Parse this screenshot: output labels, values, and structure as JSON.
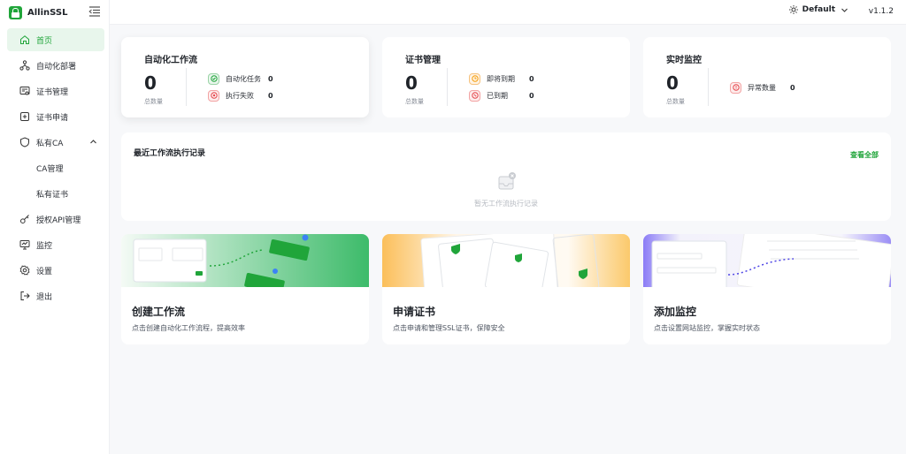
{
  "app": {
    "name": "AllinSSL",
    "theme_label": "Default",
    "version": "v1.1.2"
  },
  "sidebar": {
    "items": [
      {
        "label": "首页",
        "icon": "home-icon"
      },
      {
        "label": "自动化部署",
        "icon": "workflow-icon"
      },
      {
        "label": "证书管理",
        "icon": "certificate-icon"
      },
      {
        "label": "证书申请",
        "icon": "plus-square-icon"
      },
      {
        "label": "私有CA",
        "icon": "shield-icon"
      },
      {
        "label": "CA管理",
        "icon": ""
      },
      {
        "label": "私有证书",
        "icon": ""
      },
      {
        "label": "授权API管理",
        "icon": "key-icon"
      },
      {
        "label": "监控",
        "icon": "monitor-icon"
      },
      {
        "label": "设置",
        "icon": "gear-icon"
      },
      {
        "label": "退出",
        "icon": "logout-icon"
      }
    ]
  },
  "stats": {
    "workflow": {
      "title": "自动化工作流",
      "total": "0",
      "total_label": "总数量",
      "rows": [
        {
          "label": "自动化任务",
          "value": "0"
        },
        {
          "label": "执行失败",
          "value": "0"
        }
      ]
    },
    "cert": {
      "title": "证书管理",
      "total": "0",
      "total_label": "总数量",
      "rows": [
        {
          "label": "即将到期",
          "value": "0"
        },
        {
          "label": "已到期",
          "value": "0"
        }
      ]
    },
    "monitor": {
      "title": "实时监控",
      "total": "0",
      "total_label": "总数量",
      "rows": [
        {
          "label": "异常数量",
          "value": "0"
        }
      ]
    }
  },
  "recent": {
    "title": "最近工作流执行记录",
    "view_all": "查看全部",
    "empty": "暂无工作流执行记录"
  },
  "quick": [
    {
      "title": "创建工作流",
      "desc": "点击创建自动化工作流程，提高效率"
    },
    {
      "title": "申请证书",
      "desc": "点击申请和管理SSL证书，保障安全"
    },
    {
      "title": "添加监控",
      "desc": "点击设置网站监控，掌握实时状态"
    }
  ],
  "colors": {
    "accent": "#20a53a",
    "danger": "#e5484d",
    "warning": "#f59e0b"
  }
}
